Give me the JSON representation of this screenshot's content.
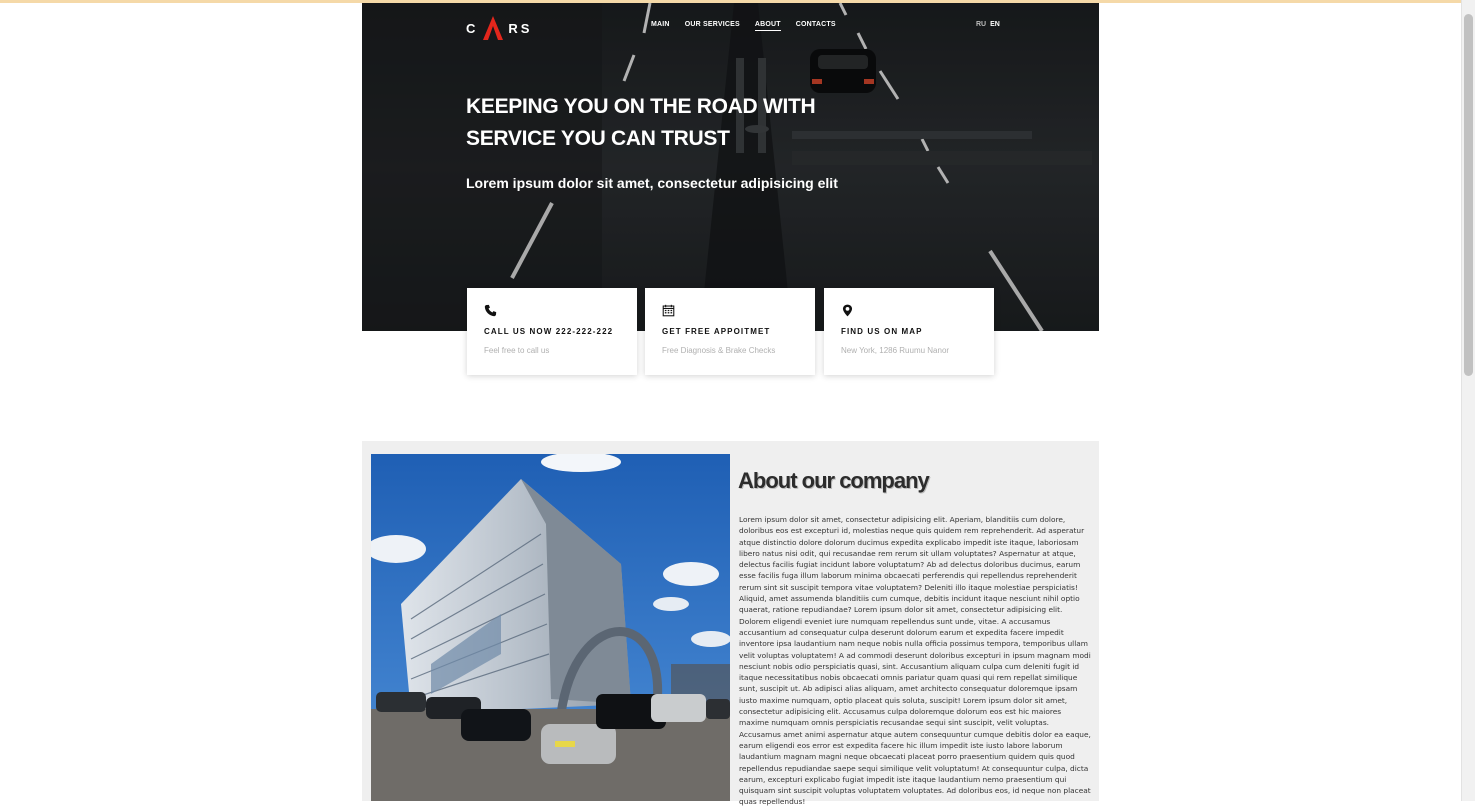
{
  "brand": {
    "logo_letters_left": "C",
    "logo_letters_right": "RS",
    "accent_color": "#e3261c"
  },
  "nav": {
    "items": [
      {
        "label": "MAIN",
        "active": false
      },
      {
        "label": "OUR SERVICES",
        "active": false
      },
      {
        "label": "ABOUT",
        "active": true
      },
      {
        "label": "CONTACTS",
        "active": false
      }
    ],
    "lang_ru": "RU",
    "lang_en": "EN"
  },
  "hero": {
    "title_line1": "KEEPING YOU ON THE ROAD WITH",
    "title_line2": "SERVICE YOU CAN TRUST",
    "subtitle": "Lorem ipsum dolor sit amet, consectetur adipisicing elit"
  },
  "cards": [
    {
      "icon": "phone-icon",
      "title": "CALL US NOW 222-222-222",
      "text": "Feel free to call us"
    },
    {
      "icon": "calendar-icon",
      "title": "GET FREE APPOITMET",
      "text": "Free Diagnosis & Brake Checks"
    },
    {
      "icon": "map-pin-icon",
      "title": "FIND US ON MAP",
      "text": "New York, 1286 Ruumu Nanor"
    }
  ],
  "about": {
    "heading": "About our company",
    "body": "Lorem ipsum dolor sit amet, consectetur adipisicing elit. Aperiam, blanditiis cum dolore, doloribus eos est excepturi id, molestias neque quis quidem rem reprehenderit. Ad asperatur atque distinctio dolore dolorum ducimus expedita explicabo impedit iste itaque, laboriosam libero natus nisi odit, qui recusandae rem rerum sit ullam voluptates? Aspernatur at atque, delectus facilis fugiat incidunt labore voluptatum? Ab ad delectus doloribus ducimus, earum esse facilis fuga illum laborum minima obcaecati perferendis qui repellendus reprehenderit rerum sint sit suscipit tempora vitae voluptatem? Deleniti illo itaque molestiae perspiciatis! Aliquid, amet assumenda blanditiis cum cumque, debitis incidunt itaque nesciunt nihil optio quaerat, ratione repudiandae? Lorem ipsum dolor sit amet, consectetur adipisicing elit. Dolorem eligendi eveniet iure numquam repellendus sunt unde, vitae. A accusamus accusantium ad consequatur culpa deserunt dolorum earum et expedita facere impedit inventore ipsa laudantium nam neque nobis nulla officia possimus tempora, temporibus ullam velit voluptas voluptatem! A ad commodi deserunt doloribus excepturi in ipsum magnam modi nesciunt nobis odio perspiciatis quasi, sint. Accusantium aliquam culpa cum deleniti fugit id itaque necessitatibus nobis obcaecati omnis pariatur quam quasi qui rem repellat similique sunt, suscipit ut. Ab adipisci alias aliquam, amet architecto consequatur doloremque ipsam iusto maxime numquam, optio placeat quis soluta, suscipit! Lorem ipsum dolor sit amet, consectetur adipisicing elit. Accusamus culpa doloremque dolorum eos est hic maiores maxime numquam omnis perspiciatis recusandae sequi sint suscipit, velit voluptas. Accusamus amet animi aspernatur atque autem consequuntur cumque debitis dolor ea eaque, earum eligendi eos error est expedita facere hic illum impedit iste iusto labore laborum laudantium magnam magni neque obcaecati placeat porro praesentium quidem quis quod repellendus repudiandae saepe sequi similique velit voluptatum! At consequuntur culpa, dicta earum, excepturi explicabo fugiat impedit iste itaque laudantium nemo praesentium qui quisquam sint suscipit voluptas voluptatem voluptates. Ad doloribus eos, id neque non placeat quas repellendus!"
  }
}
